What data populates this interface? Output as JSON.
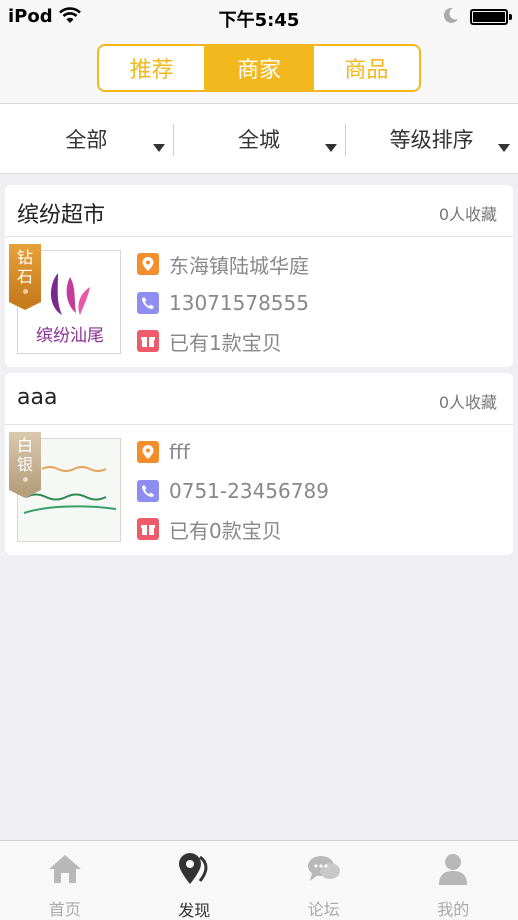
{
  "status_bar": {
    "carrier": "iPod",
    "time": "下午5:45"
  },
  "segments": [
    {
      "label": "推荐",
      "active": false
    },
    {
      "label": "商家",
      "active": true
    },
    {
      "label": "商品",
      "active": false
    }
  ],
  "filters": [
    {
      "label": "全部"
    },
    {
      "label": "全城"
    },
    {
      "label": "等级排序"
    }
  ],
  "shops": [
    {
      "name": "缤纷超市",
      "favorites": "0人收藏",
      "badge": [
        "钻",
        "石"
      ],
      "badge_tier": "gold",
      "logo_text": "缤纷汕尾",
      "address": "东海镇陆城华庭",
      "phone": "13071578555",
      "products": "已有1款宝贝"
    },
    {
      "name": "aaa",
      "favorites": "0人收藏",
      "badge": [
        "白",
        "银"
      ],
      "badge_tier": "silver",
      "logo_text": "",
      "address": "fff",
      "phone": "0751-23456789",
      "products": "已有0款宝贝"
    }
  ],
  "tabbar": [
    {
      "label": "首页",
      "icon": "home-icon",
      "active": false
    },
    {
      "label": "发现",
      "icon": "location-icon",
      "active": true
    },
    {
      "label": "论坛",
      "icon": "chat-icon",
      "active": false
    },
    {
      "label": "我的",
      "icon": "user-icon",
      "active": false
    }
  ],
  "colors": {
    "accent": "#f2b81e",
    "location": "#f28e2b",
    "phone": "#8e8df1",
    "gift": "#f05b6b"
  }
}
